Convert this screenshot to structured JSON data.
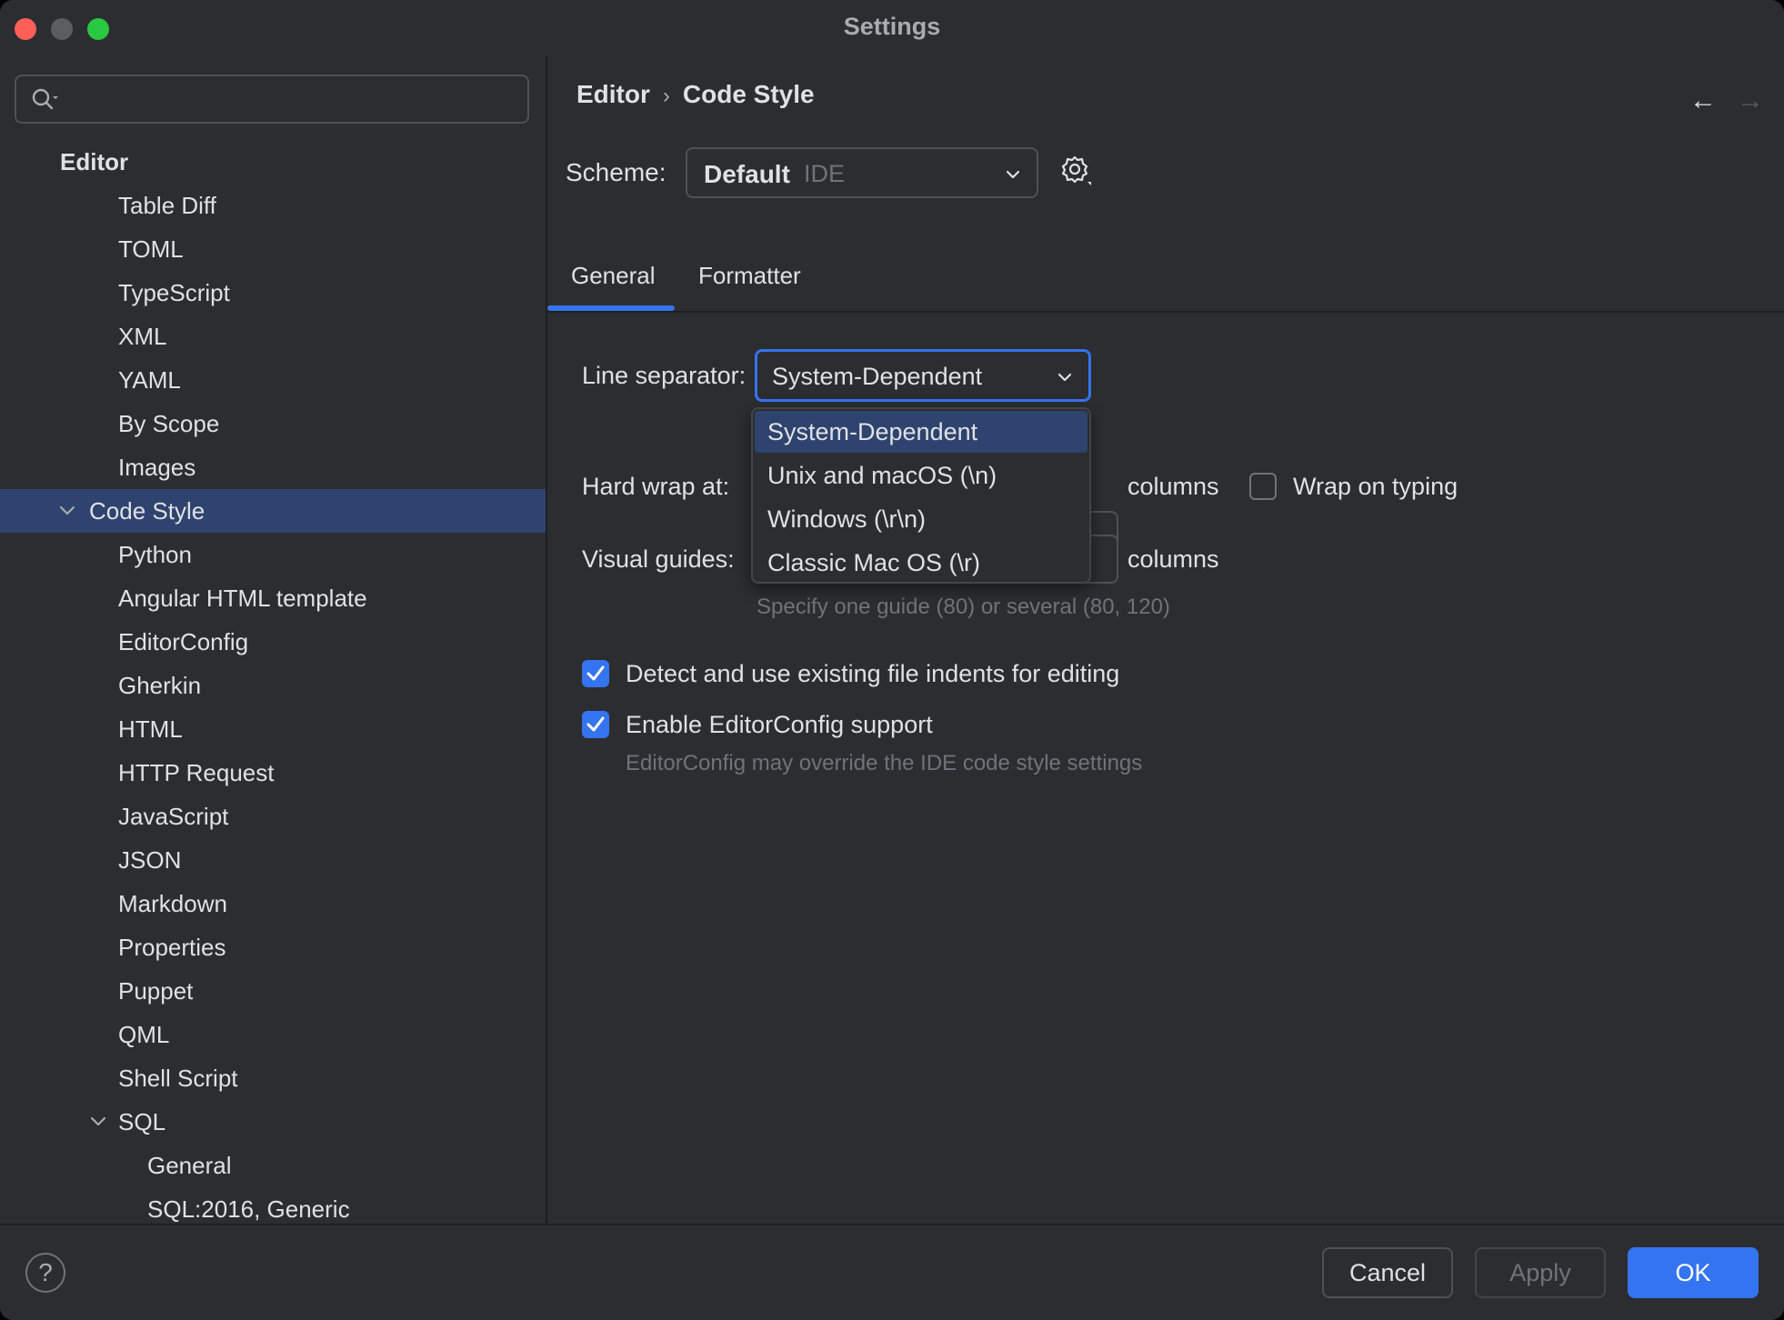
{
  "window": {
    "title": "Settings"
  },
  "sidebar": {
    "search_placeholder": "",
    "items": [
      {
        "label": "Editor",
        "level": 0,
        "bold": true,
        "expanded": null
      },
      {
        "label": "Table Diff",
        "level": 2
      },
      {
        "label": "TOML",
        "level": 2
      },
      {
        "label": "TypeScript",
        "level": 2
      },
      {
        "label": "XML",
        "level": 2
      },
      {
        "label": "YAML",
        "level": 2
      },
      {
        "label": "By Scope",
        "level": 2
      },
      {
        "label": "Images",
        "level": 2
      },
      {
        "label": "Code Style",
        "level": 1,
        "expanded": true,
        "selected": true
      },
      {
        "label": "Python",
        "level": 2
      },
      {
        "label": "Angular HTML template",
        "level": 2
      },
      {
        "label": "EditorConfig",
        "level": 2
      },
      {
        "label": "Gherkin",
        "level": 2
      },
      {
        "label": "HTML",
        "level": 2
      },
      {
        "label": "HTTP Request",
        "level": 2
      },
      {
        "label": "JavaScript",
        "level": 2
      },
      {
        "label": "JSON",
        "level": 2
      },
      {
        "label": "Markdown",
        "level": 2
      },
      {
        "label": "Properties",
        "level": 2
      },
      {
        "label": "Puppet",
        "level": 2
      },
      {
        "label": "QML",
        "level": 2
      },
      {
        "label": "Shell Script",
        "level": 2
      },
      {
        "label": "SQL",
        "level": 2,
        "expanded": true
      },
      {
        "label": "General",
        "level": 3
      },
      {
        "label": "SQL:2016, Generic",
        "level": 3
      }
    ]
  },
  "breadcrumb": {
    "parent": "Editor",
    "separator": "›",
    "current": "Code Style"
  },
  "nav": {
    "back": "←",
    "forward": "→"
  },
  "scheme": {
    "label": "Scheme:",
    "value": "Default",
    "suffix": "IDE"
  },
  "tabs": [
    {
      "label": "General",
      "active": true
    },
    {
      "label": "Formatter",
      "active": false
    }
  ],
  "general": {
    "line_separator": {
      "label": "Line separator:",
      "value": "System-Dependent"
    },
    "dropdown_options": [
      {
        "label": "System-Dependent",
        "selected": true
      },
      {
        "label": "Unix and macOS (\\n)",
        "selected": false
      },
      {
        "label": "Windows (\\r\\n)",
        "selected": false
      },
      {
        "label": "Classic Mac OS (\\r)",
        "selected": false
      }
    ],
    "hard_wrap": {
      "label": "Hard wrap at:",
      "unit": "columns"
    },
    "wrap_on_typing": {
      "label": "Wrap on typing",
      "checked": false
    },
    "visual_guides": {
      "label": "Visual guides:",
      "unit": "columns",
      "hint": "Specify one guide (80) or several (80, 120)"
    },
    "detect_indents": {
      "label": "Detect and use existing file indents for editing",
      "checked": true
    },
    "editorconfig": {
      "label": "Enable EditorConfig support",
      "checked": true,
      "hint": "EditorConfig may override the IDE code style settings"
    }
  },
  "footer": {
    "help": "?",
    "cancel": "Cancel",
    "apply": "Apply",
    "ok": "OK"
  },
  "colors": {
    "accent": "#3574f0",
    "selection": "#2e436e",
    "background": "#2b2d30"
  }
}
